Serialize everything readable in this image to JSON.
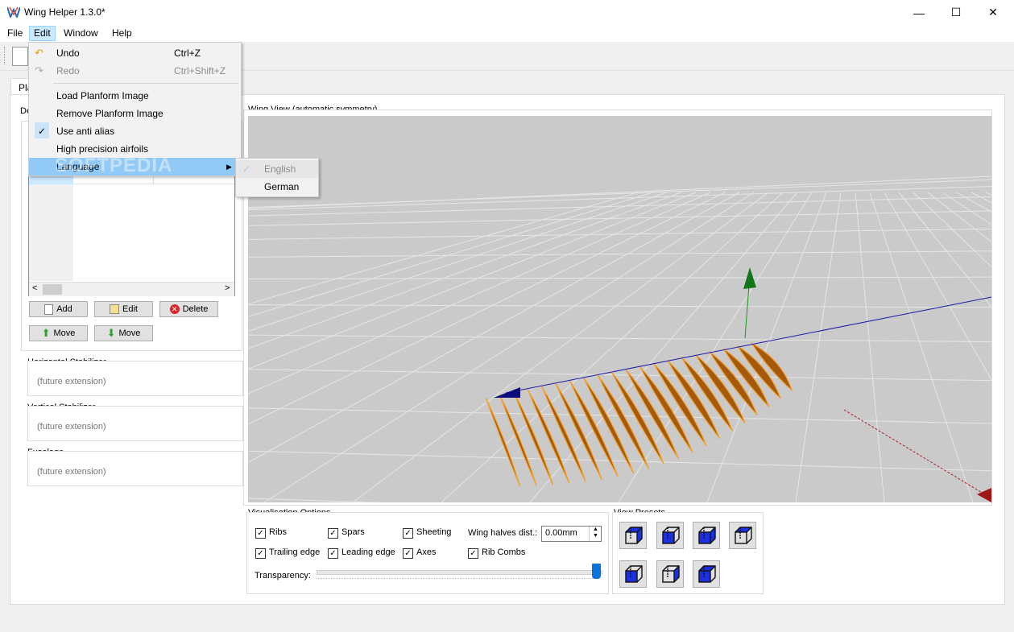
{
  "window": {
    "title": "Wing Helper 1.3.0*",
    "minimize": "—",
    "maximize": "☐",
    "close": "✕"
  },
  "menubar": {
    "file": "File",
    "edit": "Edit",
    "window": "Window",
    "help": "Help"
  },
  "tabs": {
    "planform": "Pla"
  },
  "left_panel": {
    "section_label": "De",
    "buttons": {
      "add": "Add",
      "edit": "Edit",
      "delete": "Delete",
      "move_up": "Move",
      "move_down": "Move"
    },
    "horizontal_stabilizer": {
      "title": "Horizontal Stabilizer",
      "note": "(future extension)"
    },
    "vertical_stabilizer": {
      "title": "Vertical Stabilizer",
      "note": "(future extension)"
    },
    "fuselage": {
      "title": "Fuselage",
      "note": "(future extension)"
    }
  },
  "wing_view": {
    "title": "Wing View (automatic symmetry)"
  },
  "edit_menu": {
    "undo": {
      "label": "Undo",
      "shortcut": "Ctrl+Z"
    },
    "redo": {
      "label": "Redo",
      "shortcut": "Ctrl+Shift+Z"
    },
    "load_planform": "Load Planform Image",
    "remove_planform": "Remove Planform Image",
    "anti_alias": "Use anti alias",
    "anti_alias_checked": true,
    "high_precision": "High precision airfoils",
    "language": "Language"
  },
  "language_menu": {
    "english": "English",
    "german": "German",
    "selected": "English"
  },
  "visualisation": {
    "title": "Visualisation Options",
    "ribs": "Ribs",
    "spars": "Spars",
    "sheeting": "Sheeting",
    "trailing_edge": "Trailing edge",
    "leading_edge": "Leading edge",
    "axes": "Axes",
    "rib_combs": "Rib Combs",
    "wing_halves_label": "Wing halves dist.:",
    "wing_halves_value": "0.00mm",
    "transparency_label": "Transparency:",
    "transparency_level": 1.0
  },
  "view_presets": {
    "title": "View Presets",
    "count": 7
  },
  "watermark": "SOFTPEDIA",
  "colors": {
    "accent": "#91c9f7",
    "rib_fill": "#a45a0a",
    "rib_edge": "#f0a030",
    "viewport_bg": "#c9c9c9"
  }
}
